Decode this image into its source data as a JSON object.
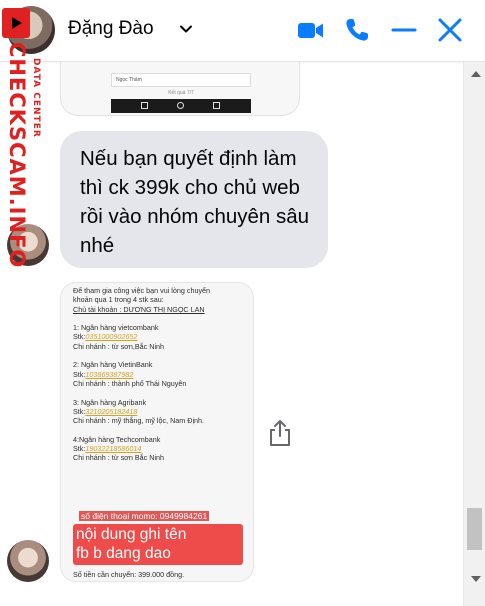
{
  "header": {
    "contact_name": "Đặng Đào",
    "accent_color": "#0084ff",
    "icons": [
      "video-call-icon",
      "phone-icon",
      "minimize-icon",
      "close-icon"
    ]
  },
  "watermark": {
    "main": "CHECKSCAM.INFO",
    "sub": "DATA CENTER"
  },
  "screenshot_top": {
    "row_text": "Ngọc Thảm",
    "row2_text": "Kết quả 7/7"
  },
  "message": {
    "text": "Nếu bạn quyết định làm thì ck 399k cho chủ web rồi vào nhóm chuyên sâu nhé"
  },
  "image": {
    "intro_1": "Để tham gia công việc bạn vui lòng chuyển",
    "intro_2": "khoản qua 1 trong 4 stk sau:",
    "owner": "Chủ tài khoản : DƯƠNG THỊ NGỌC LAN",
    "bank1_name": "1: Ngân hàng vietcombank",
    "bank1_stk_label": "Stk:",
    "bank1_stk": "0351000902652",
    "bank1_branch": "Chi nhánh : từ sơn,Bắc Ninh",
    "bank2_name": "2: Ngân hàng VietinBank",
    "bank2_stk_label": "Stk:",
    "bank2_stk": "103869387982",
    "bank2_branch": "Chi nhánh : thành phố Thái Nguyên",
    "bank3_name": "3: Ngân hàng Agribank",
    "bank3_stk_label": "Stk:",
    "bank3_stk": "3210205182418",
    "bank3_branch": "Chi nhánh : mỹ thắng, mỹ lộc, Nam Định.",
    "bank4_name": "4:Ngân hàng Techcombank",
    "bank4_stk_label": "Stk:",
    "bank4_stk": "19032218586014",
    "bank4_branch": "Chi nhánh : từ sơn Bắc Ninh",
    "phone": "số điện thoại momo: 0949984261",
    "red_line1": "nội dung ghi tên",
    "red_line2": "fb b dang dao",
    "amount": "Số tiền cần chuyển: 399.000 đồng."
  }
}
